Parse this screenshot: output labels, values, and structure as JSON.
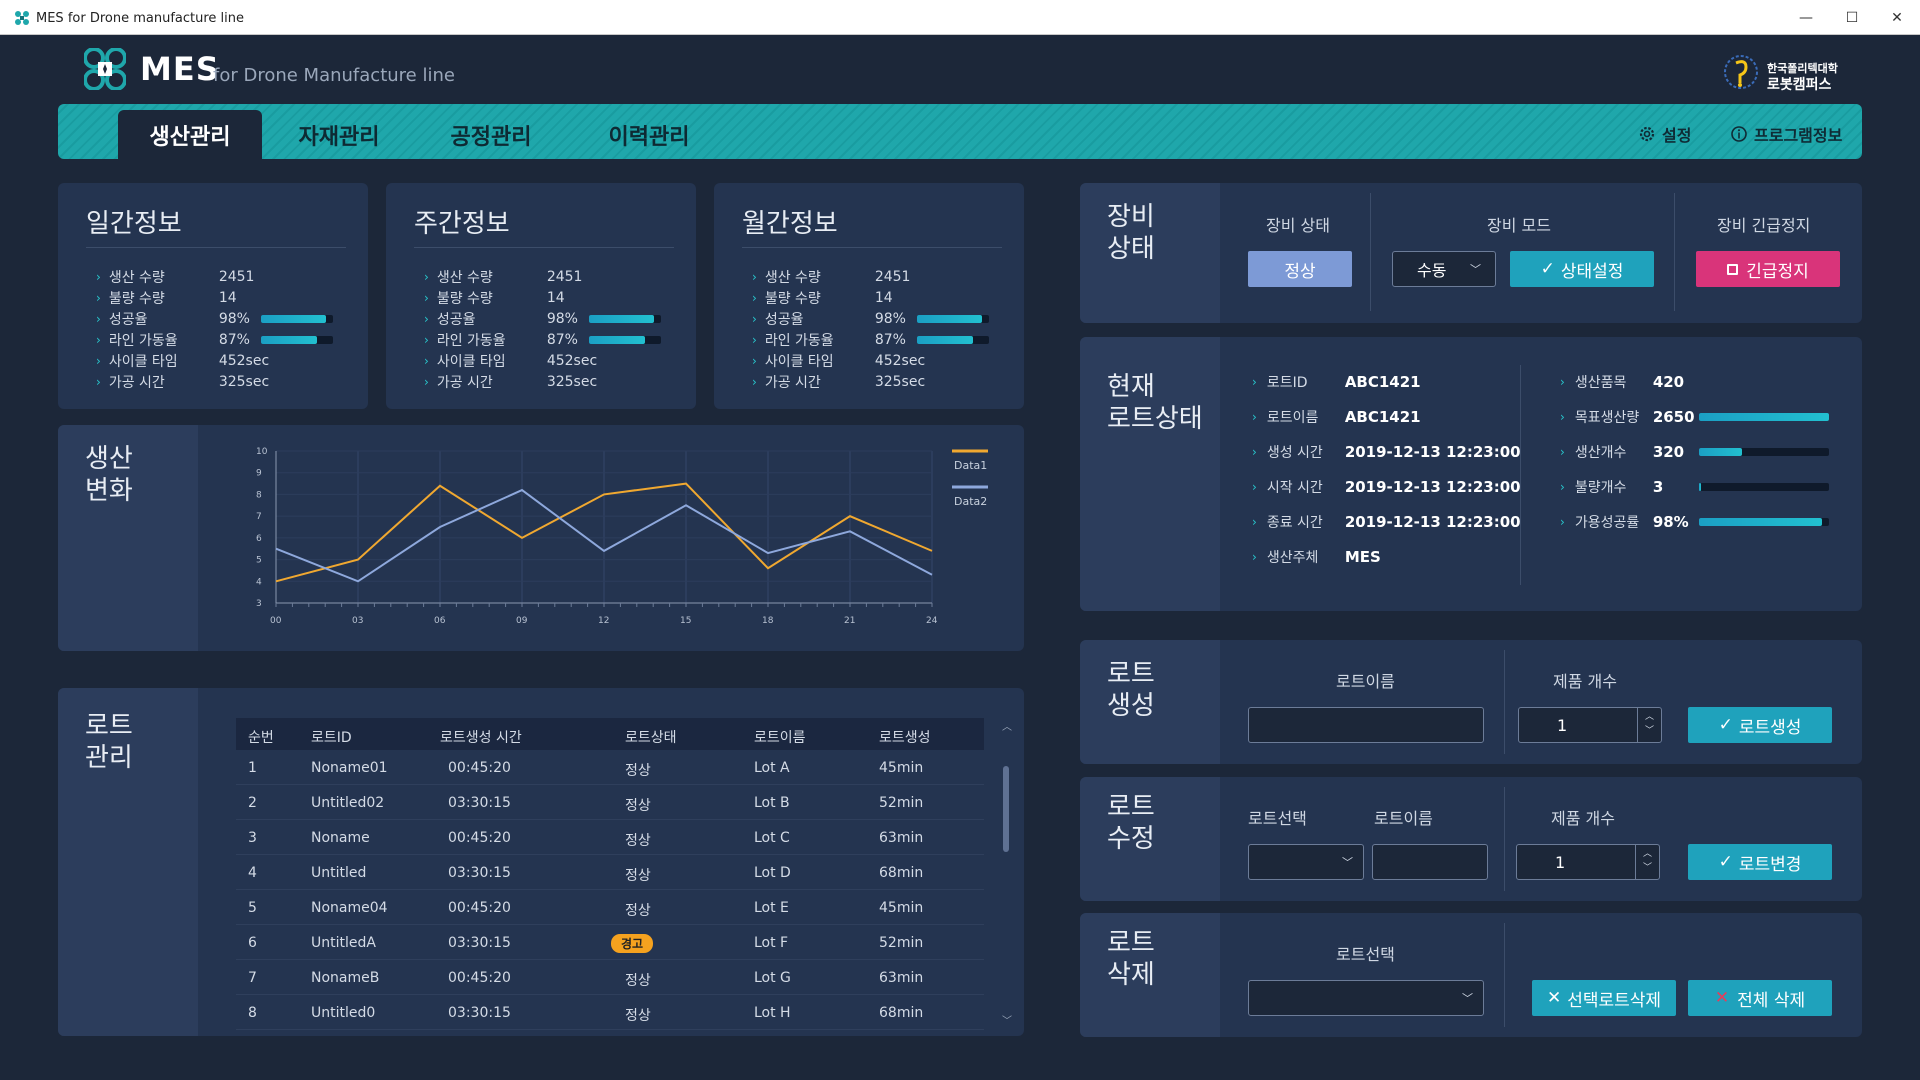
{
  "window": {
    "title": "MES for Drone manufacture line"
  },
  "brand": {
    "name": "MES",
    "subtitle": "for Drone Manufacture line",
    "partner_line1": "한국폴리텍대학",
    "partner_line2": "로봇캠퍼스"
  },
  "nav": {
    "tabs": [
      {
        "label": "생산관리"
      },
      {
        "label": "자재관리"
      },
      {
        "label": "공정관리"
      },
      {
        "label": "이력관리"
      }
    ],
    "settings_label": "설정",
    "info_label": "프로그램정보"
  },
  "info_cards": [
    {
      "title": "일간정보",
      "rows": [
        {
          "label": "생산 수량",
          "value": "2451"
        },
        {
          "label": "불량 수량",
          "value": "14"
        },
        {
          "label": "성공율",
          "value": "98%",
          "level": 0.9
        },
        {
          "label": "라인 가동율",
          "value": "87%",
          "level": 0.78
        },
        {
          "label": "사이클 타임",
          "value": "452sec"
        },
        {
          "label": "가공 시간",
          "value": "325sec"
        }
      ]
    },
    {
      "title": "주간정보",
      "rows": [
        {
          "label": "생산 수량",
          "value": "2451"
        },
        {
          "label": "불량 수량",
          "value": "14"
        },
        {
          "label": "성공율",
          "value": "98%",
          "level": 0.9
        },
        {
          "label": "라인 가동율",
          "value": "87%",
          "level": 0.78
        },
        {
          "label": "사이클 타임",
          "value": "452sec"
        },
        {
          "label": "가공 시간",
          "value": "325sec"
        }
      ]
    },
    {
      "title": "월간정보",
      "rows": [
        {
          "label": "생산 수량",
          "value": "2451"
        },
        {
          "label": "불량 수량",
          "value": "14"
        },
        {
          "label": "성공율",
          "value": "98%",
          "level": 0.9
        },
        {
          "label": "라인 가동율",
          "value": "87%",
          "level": 0.78
        },
        {
          "label": "사이클 타임",
          "value": "452sec"
        },
        {
          "label": "가공 시간",
          "value": "325sec"
        }
      ]
    }
  ],
  "production_chart": {
    "label_line1": "생산",
    "label_line2": "변화"
  },
  "chart_data": {
    "type": "line",
    "x": [
      "00",
      "03",
      "06",
      "09",
      "12",
      "15",
      "18",
      "21",
      "24"
    ],
    "series": [
      {
        "name": "Data1",
        "color": "#f0a830",
        "values": [
          4,
          5,
          8.4,
          6,
          8,
          8.5,
          4.6,
          7,
          5.4
        ]
      },
      {
        "name": "Data2",
        "color": "#8ea8dc",
        "values": [
          5.5,
          4,
          6.5,
          8.2,
          5.4,
          7.5,
          5.3,
          6.3,
          4.3
        ]
      }
    ],
    "yticks": [
      "3",
      "4",
      "5",
      "6",
      "7",
      "8",
      "9",
      "10"
    ],
    "ylim": [
      3,
      10
    ],
    "grid": true,
    "legend": "right"
  },
  "lot_table": {
    "label_line1": "로트",
    "label_line2": "관리",
    "headers": [
      "순번",
      "로트ID",
      "로트생성 시간",
      "로트상태",
      "로트이름",
      "로트생성"
    ],
    "rows": [
      [
        "1",
        "Noname01",
        "00:45:20",
        "정상",
        "Lot A",
        "45min"
      ],
      [
        "2",
        "Untitled02",
        "03:30:15",
        "정상",
        "Lot B",
        "52min"
      ],
      [
        "3",
        "Noname",
        "00:45:20",
        "정상",
        "Lot C",
        "63min"
      ],
      [
        "4",
        "Untitled",
        "03:30:15",
        "정상",
        "Lot D",
        "68min"
      ],
      [
        "5",
        "Noname04",
        "00:45:20",
        "정상",
        "Lot E",
        "45min"
      ],
      [
        "6",
        "UntitledA",
        "03:30:15",
        "경고",
        "Lot F",
        "52min"
      ],
      [
        "7",
        "NonameB",
        "00:45:20",
        "정상",
        "Lot G",
        "63min"
      ],
      [
        "8",
        "Untitled0",
        "03:30:15",
        "정상",
        "Lot H",
        "68min"
      ]
    ],
    "warning_status": "경고",
    "warning_color": "#f5a21f"
  },
  "equipment": {
    "label_line1": "장비",
    "label_line2": "상태",
    "status_label": "장비 상태",
    "status_value": "정상",
    "mode_label": "장비 모드",
    "mode_value": "수동",
    "set_button": "상태설정",
    "emergency_label": "장비 긴급정지",
    "emergency_button": "긴급정지"
  },
  "current_lot": {
    "label_line1": "현재",
    "label_line2": "로트상태",
    "left": [
      {
        "label": "로트ID",
        "value": "ABC1421"
      },
      {
        "label": "로트이름",
        "value": "ABC1421"
      },
      {
        "label": "생성 시간",
        "value": "2019-12-13 12:23:00"
      },
      {
        "label": "시작 시간",
        "value": "2019-12-13 12:23:00"
      },
      {
        "label": "종료 시간",
        "value": "2019-12-13 12:23:00"
      },
      {
        "label": "생산주체",
        "value": "MES"
      }
    ],
    "right": [
      {
        "label": "생산품목",
        "value": "420"
      },
      {
        "label": "목표생산량",
        "value": "2650",
        "level": 1.0
      },
      {
        "label": "생산개수",
        "value": "320",
        "level": 0.33
      },
      {
        "label": "불량개수",
        "value": "3",
        "level": 0.02
      },
      {
        "label": "가용성공률",
        "value": "98%",
        "level": 0.95
      }
    ]
  },
  "lot_create": {
    "label_line1": "로트",
    "label_line2": "생성",
    "name_label": "로트이름",
    "name_value": "",
    "count_label": "제품 개수",
    "count_value": "1",
    "button": "로트생성"
  },
  "lot_edit": {
    "label_line1": "로트",
    "label_line2": "수정",
    "select_label": "로트선택",
    "name_label": "로트이름",
    "count_label": "제품 개수",
    "count_value": "1",
    "button": "로트변경"
  },
  "lot_delete": {
    "label_line1": "로트",
    "label_line2": "삭제",
    "select_label": "로트선택",
    "delete_selected": "선택로트삭제",
    "delete_all": "전체 삭제"
  }
}
